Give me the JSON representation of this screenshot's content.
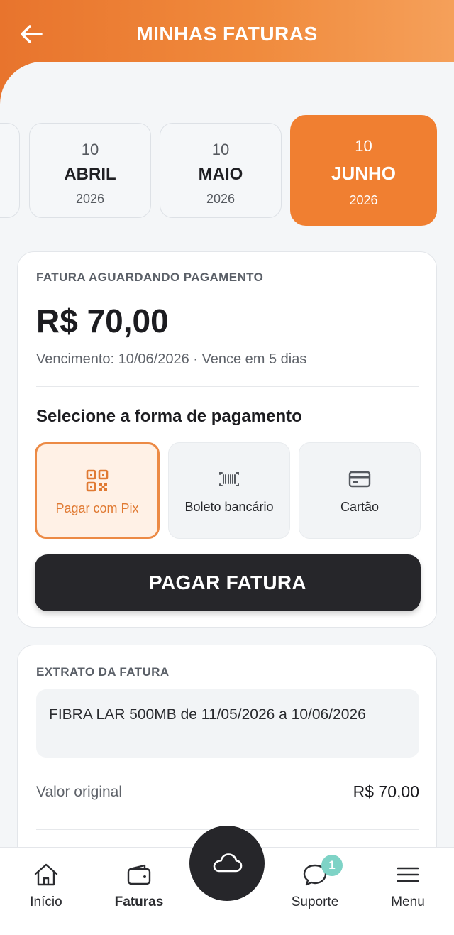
{
  "header": {
    "title": "MINHAS FATURAS"
  },
  "months": [
    {
      "day": "10",
      "month": "ABRIL",
      "year": "2026"
    },
    {
      "day": "10",
      "month": "MAIO",
      "year": "2026"
    },
    {
      "day": "10",
      "month": "JUNHO",
      "year": "2026",
      "selected": true
    }
  ],
  "invoice": {
    "status": "FATURA AGUARDANDO PAGAMENTO",
    "amount": "R$ 70,00",
    "due": "Vencimento: 10/06/2026 · Vence em 5 dias",
    "payment_title": "Selecione a forma de pagamento",
    "methods": [
      {
        "label": "Pagar com Pix",
        "icon": "qr-code-icon",
        "selected": true
      },
      {
        "label": "Boleto bancário",
        "icon": "barcode-icon"
      },
      {
        "label": "Cartão",
        "icon": "credit-card-icon"
      }
    ],
    "pay_button": "PAGAR FATURA"
  },
  "statement": {
    "title": "EXTRATO DA FATURA",
    "item": "FIBRA LAR 500MB de 11/05/2026 a 10/06/2026",
    "original_label": "Valor original",
    "original_value": "R$ 70,00"
  },
  "nav": {
    "items": [
      {
        "label": "Início",
        "icon": "home-icon"
      },
      {
        "label": "Faturas",
        "icon": "wallet-icon",
        "active": true
      },
      {
        "label": "Suporte",
        "icon": "chat-icon",
        "badge": "1"
      },
      {
        "label": "Menu",
        "icon": "menu-icon"
      }
    ],
    "center_icon": "cloud-icon"
  },
  "colors": {
    "accent": "#f07f31",
    "dark": "#26262a",
    "badge": "#7ed3c6"
  }
}
